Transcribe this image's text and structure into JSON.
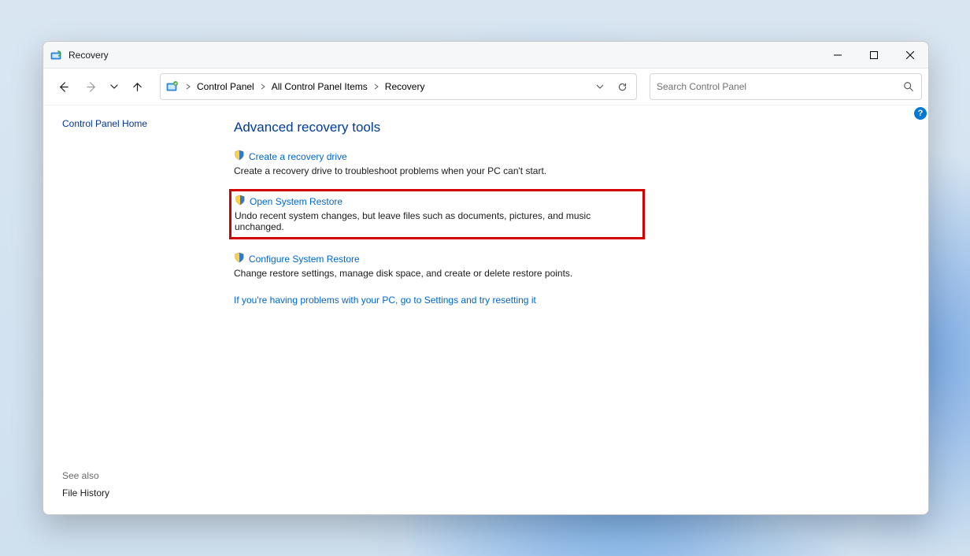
{
  "titlebar": {
    "title": "Recovery"
  },
  "breadcrumbs": {
    "item0": "Control Panel",
    "item1": "All Control Panel Items",
    "item2": "Recovery"
  },
  "search": {
    "placeholder": "Search Control Panel"
  },
  "sidebar": {
    "home": "Control Panel Home",
    "see_also": "See also",
    "file_history": "File History"
  },
  "content": {
    "heading": "Advanced recovery tools",
    "tool0": {
      "link": "Create a recovery drive",
      "desc": "Create a recovery drive to troubleshoot problems when your PC can't start."
    },
    "tool1": {
      "link": "Open System Restore",
      "desc": "Undo recent system changes, but leave files such as documents, pictures, and music unchanged."
    },
    "tool2": {
      "link": "Configure System Restore",
      "desc": "Change restore settings, manage disk space, and create or delete restore points."
    },
    "reset_link": "If you're having problems with your PC, go to Settings and try resetting it"
  },
  "help_badge": "?"
}
